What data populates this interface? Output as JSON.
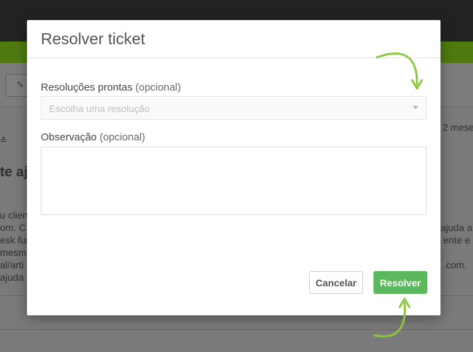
{
  "background": {
    "bg_texts": {
      "age": "2 mese",
      "heading_fragment": "te aj",
      "line1": "u clien",
      "line2a": "om. C",
      "line2b": "ajuda a",
      "line3a": "esk fun",
      "line3b": "ente e",
      "line4": "mesm",
      "line5a": "al/arti",
      "line5b": ".com.",
      "line6": "ajuda"
    }
  },
  "modal": {
    "title": "Resolver ticket",
    "ready_resolutions": {
      "label": "Resoluções prontas",
      "optional": "(opcional)",
      "placeholder": "Escolha uma resolução"
    },
    "observation": {
      "label": "Observação",
      "optional": "(opcional)",
      "value": ""
    },
    "buttons": {
      "cancel": "Cancelar",
      "resolve": "Resolver"
    }
  },
  "colors": {
    "accent_green": "#5cb85c",
    "arrow_green": "#8dc63f",
    "app_bar_green": "#4f7a0f"
  }
}
